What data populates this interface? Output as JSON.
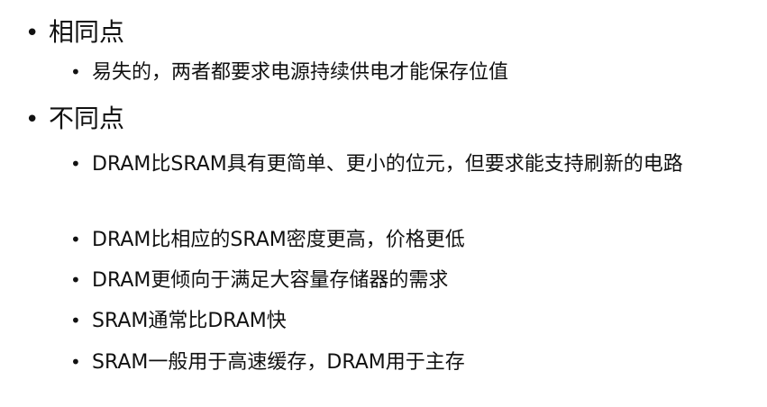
{
  "slide": {
    "bullet_char": "•",
    "sections": [
      {
        "heading": "相同点",
        "items": [
          "易失的，两者都要求电源持续供电才能保存位值"
        ]
      },
      {
        "heading": "不同点",
        "items": [
          "DRAM比SRAM具有更简单、更小的位元，但要求能支持刷新的电路",
          "DRAM比相应的SRAM密度更高，价格更低",
          "DRAM更倾向于满足大容量存储器的需求",
          "SRAM通常比DRAM快",
          "SRAM一般用于高速缓存，DRAM用于主存"
        ]
      }
    ]
  }
}
